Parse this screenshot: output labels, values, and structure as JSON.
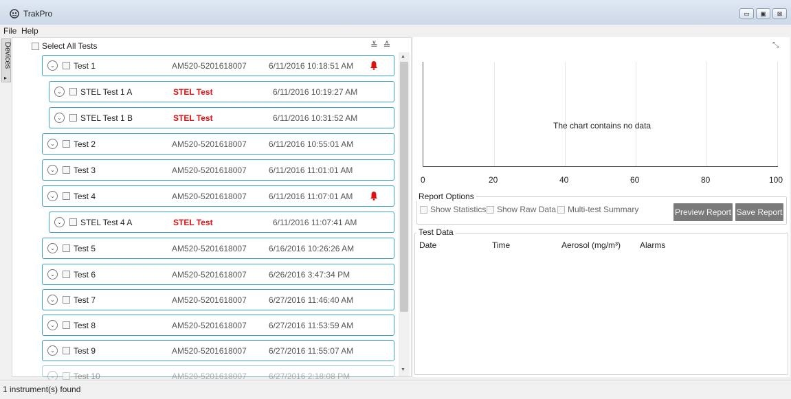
{
  "window": {
    "title": "TrakPro",
    "minimize_glyph": "▭",
    "maximize_glyph": "▣",
    "close_glyph": "⊠"
  },
  "menu": {
    "items": [
      "File",
      "Help"
    ]
  },
  "sidebar": {
    "devices_label": "Devices",
    "arrow": "▸"
  },
  "tests_panel": {
    "select_all_label": "Select All Tests",
    "collapse_all_glyph": "≚",
    "expand_all_glyph": "≙",
    "expand_glyph": "⌄",
    "rows": [
      {
        "name": "Test 1",
        "serial": "AM520-5201618007",
        "timestamp": "6/11/2016 10:18:51 AM",
        "child": false,
        "alarm": true
      },
      {
        "name": "STEL Test 1 A",
        "type": "STEL Test",
        "timestamp": "6/11/2016 10:19:27 AM",
        "child": true,
        "alarm": false
      },
      {
        "name": "STEL Test 1 B",
        "type": "STEL Test",
        "timestamp": "6/11/2016 10:31:52 AM",
        "child": true,
        "alarm": false
      },
      {
        "name": "Test 2",
        "serial": "AM520-5201618007",
        "timestamp": "6/11/2016 10:55:01 AM",
        "child": false,
        "alarm": false
      },
      {
        "name": "Test 3",
        "serial": "AM520-5201618007",
        "timestamp": "6/11/2016 11:01:01 AM",
        "child": false,
        "alarm": false
      },
      {
        "name": "Test 4",
        "serial": "AM520-5201618007",
        "timestamp": "6/11/2016 11:07:01 AM",
        "child": false,
        "alarm": true
      },
      {
        "name": "STEL Test 4 A",
        "type": "STEL Test",
        "timestamp": "6/11/2016 11:07:41 AM",
        "child": true,
        "alarm": false
      },
      {
        "name": "Test 5",
        "serial": "AM520-5201618007",
        "timestamp": "6/16/2016 10:26:26 AM",
        "child": false,
        "alarm": false
      },
      {
        "name": "Test 6",
        "serial": "AM520-5201618007",
        "timestamp": "6/26/2016 3:47:34 PM",
        "child": false,
        "alarm": false
      },
      {
        "name": "Test 7",
        "serial": "AM520-5201618007",
        "timestamp": "6/27/2016 11:46:40 AM",
        "child": false,
        "alarm": false
      },
      {
        "name": "Test 8",
        "serial": "AM520-5201618007",
        "timestamp": "6/27/2016 11:53:59 AM",
        "child": false,
        "alarm": false
      },
      {
        "name": "Test 9",
        "serial": "AM520-5201618007",
        "timestamp": "6/27/2016 11:55:07 AM",
        "child": false,
        "alarm": false
      },
      {
        "name": "Test 10",
        "serial": "AM520-5201618007",
        "timestamp": "6/27/2016 2:18:08 PM",
        "child": false,
        "alarm": false
      }
    ]
  },
  "chart": {
    "expand_glyph": "⤡",
    "empty_message": "The chart contains no data",
    "x_ticks": [
      "0",
      "20",
      "40",
      "60",
      "80",
      "100"
    ]
  },
  "report_options": {
    "title": "Report Options",
    "options": [
      "Show Statistics",
      "Show Raw Data",
      "Multi-test Summary"
    ],
    "preview_button": "Preview Report",
    "save_button": "Save Report"
  },
  "test_data": {
    "title": "Test Data",
    "columns": [
      "Date",
      "Time",
      "Aerosol (mg/m³)",
      "Alarms"
    ]
  },
  "status": {
    "text": "1 instrument(s) found"
  },
  "colors": {
    "row_border": "#38a0c4",
    "stel_text": "#e01010",
    "alarm": "#e01010",
    "button_bg": "#7a7a7a"
  },
  "icons": [
    "app-logo-icon",
    "bell-icon",
    "chevron-down-icon",
    "collapse-all-icon",
    "expand-all-icon",
    "expand-chart-icon"
  ]
}
